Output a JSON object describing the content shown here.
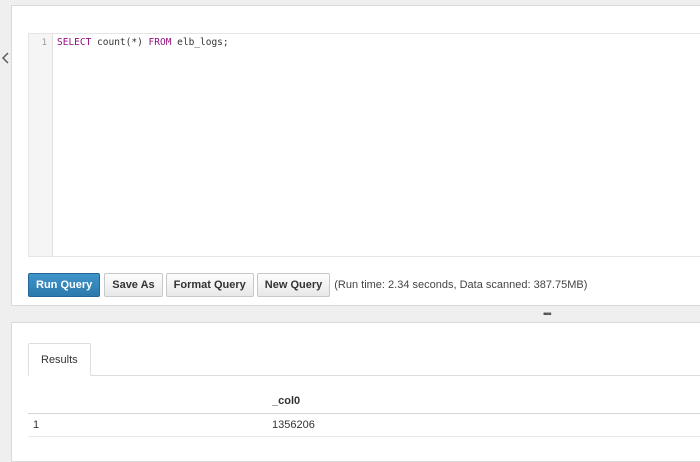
{
  "editor": {
    "line_number": "1",
    "tokens": {
      "select_kw": "SELECT",
      "fn_call": " count(*) ",
      "from_kw": "FROM",
      "table_expr": " elb_logs;"
    }
  },
  "toolbar": {
    "run_label": "Run Query",
    "save_as_label": "Save As",
    "format_label": "Format Query",
    "new_label": "New Query",
    "run_stats": "(Run time: 2.34 seconds, Data scanned: 387.75MB)"
  },
  "results": {
    "tab_label": "Results",
    "columns": [
      "",
      "_col0"
    ],
    "rows": [
      [
        "1",
        "1356206"
      ]
    ]
  },
  "icons": {
    "collapse": "chevron-left-icon",
    "resize": "drag-handle-icon"
  },
  "colors": {
    "primary_button": "#2c79ad",
    "sql_keyword": "#930f80"
  }
}
